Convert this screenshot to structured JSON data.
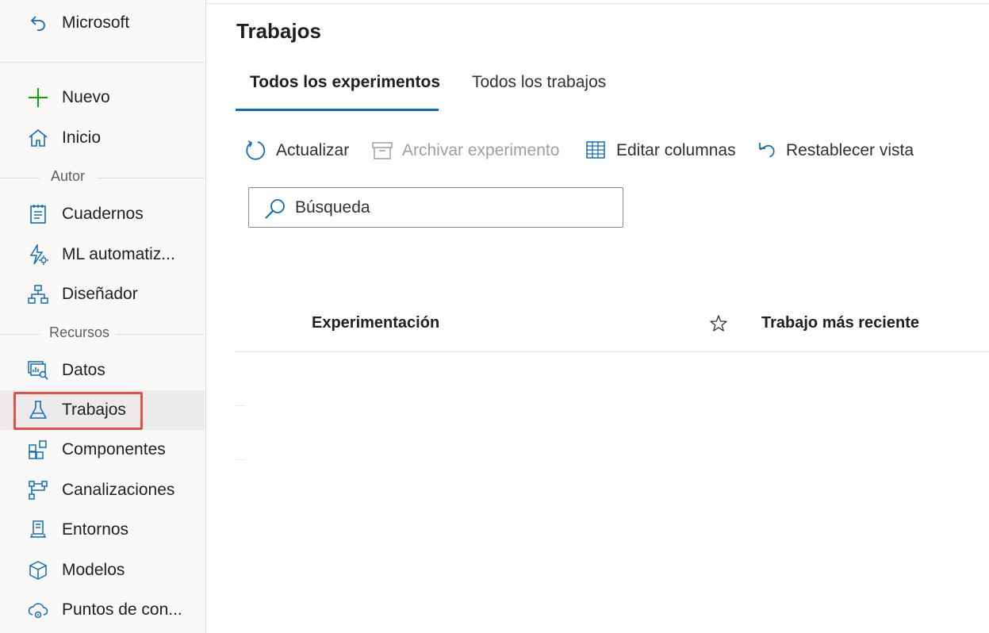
{
  "sidebar": {
    "back": {
      "label": "Microsoft"
    },
    "top_items": [
      {
        "label": "Nuevo",
        "icon": "plus-icon"
      },
      {
        "label": "Inicio",
        "icon": "home-icon"
      }
    ],
    "sections": [
      {
        "title": "Autor",
        "items": [
          {
            "label": "Cuadernos",
            "icon": "notebook-icon"
          },
          {
            "label": "ML automatiz...",
            "icon": "automl-icon"
          },
          {
            "label": "Diseñador",
            "icon": "designer-icon"
          }
        ]
      },
      {
        "title": "Recursos",
        "items": [
          {
            "label": "Datos",
            "icon": "data-icon"
          },
          {
            "label": "Trabajos",
            "icon": "flask-icon",
            "selected": true
          },
          {
            "label": "Componentes",
            "icon": "components-icon"
          },
          {
            "label": "Canalizaciones",
            "icon": "pipelines-icon"
          },
          {
            "label": "Entornos",
            "icon": "environments-icon"
          },
          {
            "label": "Modelos",
            "icon": "cube-icon"
          },
          {
            "label": "Puntos de con...",
            "icon": "endpoints-icon"
          }
        ]
      }
    ]
  },
  "main": {
    "title": "Trabajos",
    "tabs": [
      {
        "label": "Todos los experimentos",
        "active": true
      },
      {
        "label": "Todos los trabajos",
        "active": false
      }
    ],
    "commands": [
      {
        "label": "Actualizar",
        "icon": "refresh-icon",
        "disabled": false
      },
      {
        "label": "Archivar experimento",
        "icon": "archive-icon",
        "disabled": true
      },
      {
        "label": "Editar columnas",
        "icon": "edit-columns-icon",
        "disabled": false
      },
      {
        "label": "Restablecer vista",
        "icon": "reset-icon",
        "disabled": false
      }
    ],
    "search": {
      "placeholder": "Búsqueda",
      "value": ""
    },
    "table": {
      "columns": [
        "Experimentación",
        "Trabajo más reciente"
      ],
      "rows": []
    }
  },
  "colors": {
    "accent": "#0f6cbd",
    "selected_bg": "#edebe9",
    "highlight": "#e0514c",
    "plus": "#13a10e"
  }
}
